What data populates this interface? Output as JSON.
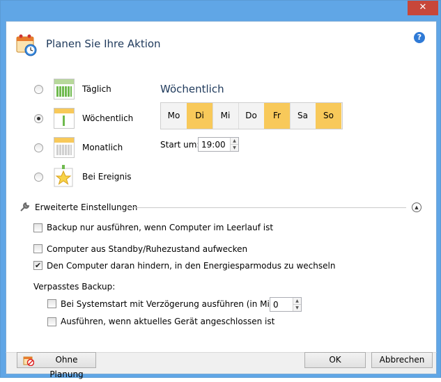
{
  "window": {
    "close_glyph": "✕"
  },
  "header": {
    "title": "Planen Sie Ihre Aktion",
    "help_glyph": "?"
  },
  "schedule_options": [
    {
      "label": "Täglich",
      "selected": false,
      "icon": "calendar-daily-icon"
    },
    {
      "label": "Wöchentlich",
      "selected": true,
      "icon": "calendar-weekly-icon"
    },
    {
      "label": "Monatlich",
      "selected": false,
      "icon": "calendar-monthly-icon"
    },
    {
      "label": "Bei Ereignis",
      "selected": false,
      "icon": "event-star-icon"
    }
  ],
  "weekly": {
    "heading": "Wöchentlich",
    "days": [
      {
        "label": "Mo",
        "active": false
      },
      {
        "label": "Di",
        "active": true
      },
      {
        "label": "Mi",
        "active": false
      },
      {
        "label": "Do",
        "active": false
      },
      {
        "label": "Fr",
        "active": true
      },
      {
        "label": "Sa",
        "active": false
      },
      {
        "label": "So",
        "active": true
      }
    ],
    "start_label": "Start um:",
    "start_value": "19:00",
    "active_color": "#f8c95a"
  },
  "advanced": {
    "title": "Erweiterte Einstellungen",
    "options": [
      {
        "label": "Backup nur ausführen, wenn Computer im Leerlauf ist",
        "checked": false
      },
      {
        "label": "Computer aus Standby/Ruhezustand aufwecken",
        "checked": false
      },
      {
        "label": "Den Computer daran hindern, in den Energiesparmodus zu wechseln",
        "checked": true
      }
    ],
    "missed_label": "Verpasstes Backup:",
    "missed_options": [
      {
        "label": "Bei Systemstart mit Verzögerung ausführen (in Minuten):",
        "checked": false,
        "value": "0"
      },
      {
        "label": "Ausführen, wenn aktuelles Gerät angeschlossen ist",
        "checked": false
      }
    ]
  },
  "footer": {
    "no_schedule_label": "Ohne Planung",
    "ok_label": "OK",
    "cancel_label": "Abbrechen"
  },
  "colors": {
    "title_bar": "#60a6e6",
    "close_button": "#c7473a",
    "heading": "#1e395b"
  }
}
